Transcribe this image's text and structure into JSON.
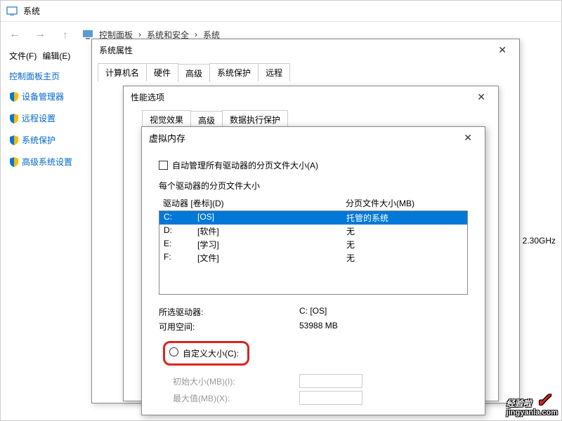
{
  "main": {
    "title": "系统",
    "breadcrumb": [
      "控制面板",
      "系统和安全",
      "系统"
    ],
    "menu": {
      "file": "文件(F)",
      "edit": "编辑(E)"
    },
    "sidebar_title": "控制面板主页",
    "sidebar": [
      {
        "label": "设备管理器"
      },
      {
        "label": "远程设置"
      },
      {
        "label": "系统保护"
      },
      {
        "label": "高级系统设置"
      }
    ],
    "cpu": ") 2.30GHz"
  },
  "sysprops": {
    "title": "系统属性",
    "tabs": [
      "计算机名",
      "硬件",
      "高级",
      "系统保护",
      "远程"
    ]
  },
  "perf": {
    "title": "性能选项",
    "tabs": [
      "视觉效果",
      "高级",
      "数据执行保护"
    ]
  },
  "vm": {
    "title": "虚拟内存",
    "auto_manage": "自动管理所有驱动器的分页文件大小(A)",
    "section_label": "每个驱动器的分页文件大小",
    "col_drive": "驱动器 [卷标](D)",
    "col_page": "分页文件大小(MB)",
    "drives": [
      {
        "letter": "C:",
        "label": "[OS]",
        "size": "托管的系统",
        "selected": true
      },
      {
        "letter": "D:",
        "label": "[软件]",
        "size": "无",
        "selected": false
      },
      {
        "letter": "E:",
        "label": "[学习]",
        "size": "无",
        "selected": false
      },
      {
        "letter": "F:",
        "label": "[文件]",
        "size": "无",
        "selected": false
      }
    ],
    "selected_drive_label": "所选驱动器:",
    "selected_drive_value": "C:  [OS]",
    "free_space_label": "可用空间:",
    "free_space_value": "53988 MB",
    "custom_size": "自定义大小(C):",
    "initial_size": "初始大小(MB)(I):",
    "max_size": "最大值(MB)(X):"
  },
  "watermark": {
    "main": "经验啦",
    "check": "✓",
    "sub": "jingyanla.com"
  }
}
